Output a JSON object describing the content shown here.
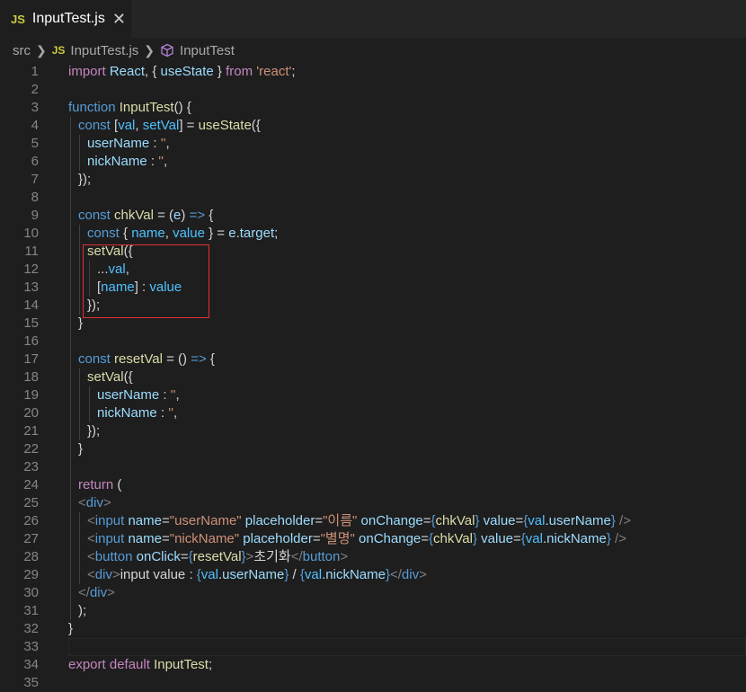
{
  "tab": {
    "badge": "JS",
    "title": "InputTest.js",
    "close": "✕"
  },
  "breadcrumb": {
    "folder": "src",
    "file_badge": "JS",
    "file": "InputTest.js",
    "symbol": "InputTest"
  },
  "lines": [
    {
      "n": "1",
      "indent": 0,
      "tokens": [
        [
          "k2",
          "import "
        ],
        [
          "vr",
          "React"
        ],
        [
          "tx",
          ", { "
        ],
        [
          "vr",
          "useState"
        ],
        [
          "tx",
          " } "
        ],
        [
          "k2",
          "from "
        ],
        [
          "st",
          "'react'"
        ],
        [
          "tx",
          ";"
        ]
      ]
    },
    {
      "n": "2",
      "indent": 0,
      "tokens": []
    },
    {
      "n": "3",
      "indent": 0,
      "tokens": [
        [
          "k1",
          "function "
        ],
        [
          "fn",
          "InputTest"
        ],
        [
          "tx",
          "() {"
        ]
      ]
    },
    {
      "n": "4",
      "indent": 1,
      "tokens": [
        [
          "k1",
          "const "
        ],
        [
          "tx",
          "["
        ],
        [
          "cn",
          "val"
        ],
        [
          "tx",
          ", "
        ],
        [
          "cn",
          "setVal"
        ],
        [
          "tx",
          "] = "
        ],
        [
          "fn",
          "useState"
        ],
        [
          "tx",
          "({"
        ]
      ]
    },
    {
      "n": "5",
      "indent": 2,
      "tokens": [
        [
          "vr",
          "userName"
        ],
        [
          "tx",
          " : "
        ],
        [
          "st",
          "''"
        ],
        [
          "tx",
          ","
        ]
      ]
    },
    {
      "n": "6",
      "indent": 2,
      "tokens": [
        [
          "vr",
          "nickName"
        ],
        [
          "tx",
          " : "
        ],
        [
          "st",
          "''"
        ],
        [
          "tx",
          ","
        ]
      ]
    },
    {
      "n": "7",
      "indent": 1,
      "tokens": [
        [
          "tx",
          "});"
        ]
      ]
    },
    {
      "n": "8",
      "indent": 0,
      "tokens": []
    },
    {
      "n": "9",
      "indent": 1,
      "tokens": [
        [
          "k1",
          "const "
        ],
        [
          "fn",
          "chkVal"
        ],
        [
          "tx",
          " = ("
        ],
        [
          "vr",
          "e"
        ],
        [
          "tx",
          ") "
        ],
        [
          "k1",
          "=>"
        ],
        [
          "tx",
          " {"
        ]
      ]
    },
    {
      "n": "10",
      "indent": 2,
      "tokens": [
        [
          "k1",
          "const "
        ],
        [
          "tx",
          "{ "
        ],
        [
          "cn",
          "name"
        ],
        [
          "tx",
          ", "
        ],
        [
          "cn",
          "value"
        ],
        [
          "tx",
          " } = "
        ],
        [
          "vr",
          "e"
        ],
        [
          "tx",
          "."
        ],
        [
          "vr",
          "target"
        ],
        [
          "tx",
          ";"
        ]
      ]
    },
    {
      "n": "11",
      "indent": 2,
      "tokens": [
        [
          "fn",
          "setVal"
        ],
        [
          "tx",
          "({"
        ]
      ]
    },
    {
      "n": "12",
      "indent": 3,
      "tokens": [
        [
          "tx",
          "..."
        ],
        [
          "cn",
          "val"
        ],
        [
          "tx",
          ","
        ]
      ]
    },
    {
      "n": "13",
      "indent": 3,
      "tokens": [
        [
          "tx",
          "["
        ],
        [
          "cn",
          "name"
        ],
        [
          "tx",
          "] : "
        ],
        [
          "cn",
          "value"
        ]
      ]
    },
    {
      "n": "14",
      "indent": 2,
      "tokens": [
        [
          "tx",
          "});"
        ]
      ]
    },
    {
      "n": "15",
      "indent": 1,
      "tokens": [
        [
          "tx",
          "}"
        ]
      ]
    },
    {
      "n": "16",
      "indent": 0,
      "tokens": []
    },
    {
      "n": "17",
      "indent": 1,
      "tokens": [
        [
          "k1",
          "const "
        ],
        [
          "fn",
          "resetVal"
        ],
        [
          "tx",
          " = () "
        ],
        [
          "k1",
          "=>"
        ],
        [
          "tx",
          " {"
        ]
      ]
    },
    {
      "n": "18",
      "indent": 2,
      "tokens": [
        [
          "fn",
          "setVal"
        ],
        [
          "tx",
          "({"
        ]
      ]
    },
    {
      "n": "19",
      "indent": 3,
      "tokens": [
        [
          "vr",
          "userName"
        ],
        [
          "tx",
          " : "
        ],
        [
          "st",
          "''"
        ],
        [
          "tx",
          ","
        ]
      ]
    },
    {
      "n": "20",
      "indent": 3,
      "tokens": [
        [
          "vr",
          "nickName"
        ],
        [
          "tx",
          " : "
        ],
        [
          "st",
          "''"
        ],
        [
          "tx",
          ","
        ]
      ]
    },
    {
      "n": "21",
      "indent": 2,
      "tokens": [
        [
          "tx",
          "});"
        ]
      ]
    },
    {
      "n": "22",
      "indent": 1,
      "tokens": [
        [
          "tx",
          "}"
        ]
      ]
    },
    {
      "n": "23",
      "indent": 0,
      "tokens": []
    },
    {
      "n": "24",
      "indent": 1,
      "tokens": [
        [
          "k2",
          "return "
        ],
        [
          "tx",
          "("
        ]
      ]
    },
    {
      "n": "25",
      "indent": 1,
      "tokens": [
        [
          "pt",
          "<"
        ],
        [
          "tg",
          "div"
        ],
        [
          "pt",
          ">"
        ]
      ]
    },
    {
      "n": "26",
      "indent": 2,
      "tokens": [
        [
          "pt",
          "<"
        ],
        [
          "tg",
          "input "
        ],
        [
          "at",
          "name"
        ],
        [
          "tx",
          "="
        ],
        [
          "st",
          "\"userName\" "
        ],
        [
          "at",
          "placeholder"
        ],
        [
          "tx",
          "="
        ],
        [
          "st",
          "\"이름\" "
        ],
        [
          "at",
          "onChange"
        ],
        [
          "tx",
          "="
        ],
        [
          "k1",
          "{"
        ],
        [
          "fn",
          "chkVal"
        ],
        [
          "k1",
          "} "
        ],
        [
          "at",
          "value"
        ],
        [
          "tx",
          "="
        ],
        [
          "k1",
          "{"
        ],
        [
          "cn",
          "val"
        ],
        [
          "tx",
          "."
        ],
        [
          "vr",
          "userName"
        ],
        [
          "k1",
          "} "
        ],
        [
          "pt",
          "/>"
        ]
      ]
    },
    {
      "n": "27",
      "indent": 2,
      "tokens": [
        [
          "pt",
          "<"
        ],
        [
          "tg",
          "input "
        ],
        [
          "at",
          "name"
        ],
        [
          "tx",
          "="
        ],
        [
          "st",
          "\"nickName\" "
        ],
        [
          "at",
          "placeholder"
        ],
        [
          "tx",
          "="
        ],
        [
          "st",
          "\"별명\" "
        ],
        [
          "at",
          "onChange"
        ],
        [
          "tx",
          "="
        ],
        [
          "k1",
          "{"
        ],
        [
          "fn",
          "chkVal"
        ],
        [
          "k1",
          "} "
        ],
        [
          "at",
          "value"
        ],
        [
          "tx",
          "="
        ],
        [
          "k1",
          "{"
        ],
        [
          "cn",
          "val"
        ],
        [
          "tx",
          "."
        ],
        [
          "vr",
          "nickName"
        ],
        [
          "k1",
          "} "
        ],
        [
          "pt",
          "/>"
        ]
      ]
    },
    {
      "n": "28",
      "indent": 2,
      "tokens": [
        [
          "pt",
          "<"
        ],
        [
          "tg",
          "button "
        ],
        [
          "at",
          "onClick"
        ],
        [
          "tx",
          "="
        ],
        [
          "k1",
          "{"
        ],
        [
          "fn",
          "resetVal"
        ],
        [
          "k1",
          "}"
        ],
        [
          "pt",
          ">"
        ],
        [
          "tx",
          "초기화"
        ],
        [
          "pt",
          "</"
        ],
        [
          "tg",
          "button"
        ],
        [
          "pt",
          ">"
        ]
      ]
    },
    {
      "n": "29",
      "indent": 2,
      "tokens": [
        [
          "pt",
          "<"
        ],
        [
          "tg",
          "div"
        ],
        [
          "pt",
          ">"
        ],
        [
          "tx",
          "input value : "
        ],
        [
          "k1",
          "{"
        ],
        [
          "cn",
          "val"
        ],
        [
          "tx",
          "."
        ],
        [
          "vr",
          "userName"
        ],
        [
          "k1",
          "}"
        ],
        [
          "tx",
          " / "
        ],
        [
          "k1",
          "{"
        ],
        [
          "cn",
          "val"
        ],
        [
          "tx",
          "."
        ],
        [
          "vr",
          "nickName"
        ],
        [
          "k1",
          "}"
        ],
        [
          "pt",
          "</"
        ],
        [
          "tg",
          "div"
        ],
        [
          "pt",
          ">"
        ]
      ]
    },
    {
      "n": "30",
      "indent": 1,
      "tokens": [
        [
          "pt",
          "</"
        ],
        [
          "tg",
          "div"
        ],
        [
          "pt",
          ">"
        ]
      ]
    },
    {
      "n": "31",
      "indent": 1,
      "tokens": [
        [
          "tx",
          ");"
        ]
      ]
    },
    {
      "n": "32",
      "indent": 0,
      "tokens": [
        [
          "tx",
          "}"
        ]
      ]
    },
    {
      "n": "33",
      "indent": 0,
      "tokens": []
    },
    {
      "n": "34",
      "indent": 0,
      "tokens": [
        [
          "k2",
          "export "
        ],
        [
          "k2",
          "default "
        ],
        [
          "fn",
          "InputTest"
        ],
        [
          "tx",
          ";"
        ]
      ]
    },
    {
      "n": "35",
      "indent": 0,
      "tokens": []
    }
  ]
}
